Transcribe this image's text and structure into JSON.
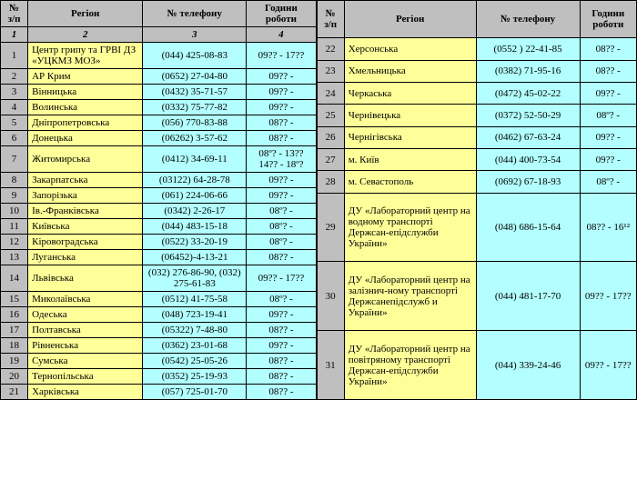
{
  "headers": {
    "num": "№ з/п",
    "region": "Регіон",
    "phone": "№ телефону",
    "hours": "Години роботи",
    "c1": "1",
    "c2": "2",
    "c3": "3",
    "c4": "4"
  },
  "left_rows": [
    {
      "n": "1",
      "region": "Центр грипу та ГРВІ ДЗ «УЦКМЗ МОЗ»",
      "tel": "(044) 425-08-83",
      "hrs": "09?? - 17??"
    },
    {
      "n": "2",
      "region": "АР Крим",
      "tel": "(0652) 27-04-80",
      "hrs": "09?? -"
    },
    {
      "n": "3",
      "region": "Вінницька",
      "tel": "(0432) 35-71-57",
      "hrs": "09?? -"
    },
    {
      "n": "4",
      "region": "Волинська",
      "tel": "(0332) 75-77-82",
      "hrs": "09?? -"
    },
    {
      "n": "5",
      "region": "Дніпропетровська",
      "tel": "(056) 770-83-88",
      "hrs": "08?? -"
    },
    {
      "n": "6",
      "region": "Донецька",
      "tel": "(06262) 3-57-62",
      "hrs": "08?? -"
    },
    {
      "n": "7",
      "region": "Житомирська",
      "tel": "(0412) 34-69-11",
      "hrs": "08º? - 13?? 14?? - 18º?"
    },
    {
      "n": "8",
      "region": "Закарпатська",
      "tel": "(03122) 64-28-78",
      "hrs": "09?? -"
    },
    {
      "n": "9",
      "region": "Запорізька",
      "tel": "(061) 224-06-66",
      "hrs": "09?? -"
    },
    {
      "n": "10",
      "region": "Ів.-Франківська",
      "tel": "(0342) 2-26-17",
      "hrs": "08º? -"
    },
    {
      "n": "11",
      "region": "Київська",
      "tel": "(044) 483-15-18",
      "hrs": "08º? -"
    },
    {
      "n": "12",
      "region": "Кіровоградська",
      "tel": "(0522) 33-20-19",
      "hrs": "08º? -"
    },
    {
      "n": "13",
      "region": "Луганська",
      "tel": "(06452)-4-13-21",
      "hrs": "08?? -"
    },
    {
      "n": "14",
      "region": "Львівська",
      "tel": "(032) 276-86-90, (032) 275-61-83",
      "hrs": "09?? - 17??"
    },
    {
      "n": "15",
      "region": "Миколаївська",
      "tel": "(0512) 41-75-58",
      "hrs": "08º? -"
    },
    {
      "n": "16",
      "region": "Одеська",
      "tel": "(048) 723-19-41",
      "hrs": "09?? -"
    },
    {
      "n": "17",
      "region": "Полтавська",
      "tel": "(05322) 7-48-80",
      "hrs": "08?? -"
    },
    {
      "n": "18",
      "region": "Рівненська",
      "tel": "(0362) 23-01-68",
      "hrs": "09?? -"
    },
    {
      "n": "19",
      "region": "Сумська",
      "tel": "(0542) 25-05-26",
      "hrs": "08?? -"
    },
    {
      "n": "20",
      "region": "Тернопільська",
      "tel": "(0352) 25-19-93",
      "hrs": "08?? -"
    },
    {
      "n": "21",
      "region": "Харківська",
      "tel": "(057) 725-01-70",
      "hrs": "08?? -"
    }
  ],
  "right_rows": [
    {
      "n": "22",
      "region": "Херсонська",
      "tel": "(0552 ) 22-41-85",
      "hrs": "08?? -"
    },
    {
      "n": "23",
      "region": "Хмельницька",
      "tel": "(0382) 71-95-16",
      "hrs": "08?? -"
    },
    {
      "n": "24",
      "region": "Черкаська",
      "tel": "(0472) 45-02-22",
      "hrs": "09?? -"
    },
    {
      "n": "25",
      "region": "Чернівецька",
      "tel": "(0372) 52-50-29",
      "hrs": "08º? -"
    },
    {
      "n": "26",
      "region": "Чернігівська",
      "tel": "(0462) 67-63-24",
      "hrs": "09?? -"
    },
    {
      "n": "27",
      "region": "м. Київ",
      "tel": "(044) 400-73-54",
      "hrs": "09?? -"
    },
    {
      "n": "28",
      "region": "м. Севастополь",
      "tel": "(0692) 67-18-93",
      "hrs": "08º? -"
    },
    {
      "n": "29",
      "region": "ДУ «Лабораторний центр на водному транспорті Держсан-епідслужби України»",
      "tel": "(048) 686-15-64",
      "hrs": "08?? - 16¹²"
    },
    {
      "n": "30",
      "region": "ДУ «Лабораторний центр на залізнич-ному транспорті Держсанепідслужб и України»",
      "tel": "(044) 481-17-70",
      "hrs": "09?? - 17??"
    },
    {
      "n": "31",
      "region": "ДУ «Лабораторний центр на повітряному транспорті Держсан-епідслужби України»",
      "tel": "(044) 339-24-46",
      "hrs": "09?? - 17??"
    }
  ]
}
